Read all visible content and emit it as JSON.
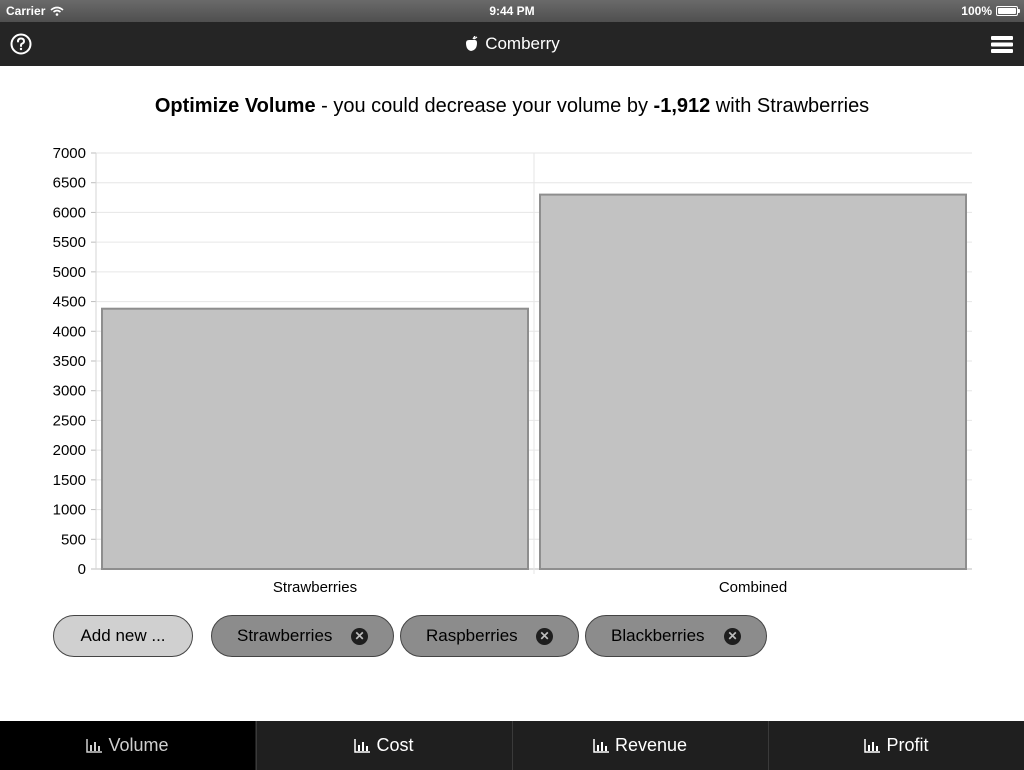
{
  "status": {
    "carrier": "Carrier",
    "time": "9:44 PM",
    "battery": "100%"
  },
  "nav": {
    "title": "Comberry",
    "help_icon": "question-circle-icon",
    "menu_icon": "hamburger-menu-icon"
  },
  "headline": {
    "metric": "Optimize Volume",
    "text_before": " - you could decrease your volume by ",
    "amount": "-1,912",
    "text_after": " with Strawberries"
  },
  "chart_data": {
    "type": "bar",
    "categories": [
      "Strawberries",
      "Combined"
    ],
    "values": [
      4380,
      6300
    ],
    "ylim": [
      0,
      7000
    ],
    "yticks": [
      0,
      500,
      1000,
      1500,
      2000,
      2500,
      3000,
      3500,
      4000,
      4500,
      5000,
      5500,
      6000,
      6500,
      7000
    ],
    "grid": true,
    "bar_color": "#c2c2c2",
    "bar_border": "#8e8e8e"
  },
  "chips": {
    "add_label": "Add new ...",
    "items": [
      {
        "label": "Strawberries"
      },
      {
        "label": "Raspberries"
      },
      {
        "label": "Blackberries"
      }
    ],
    "remove_icon": "close-circle-icon"
  },
  "tabs": [
    {
      "label": "Volume",
      "icon": "bar-chart-icon"
    },
    {
      "label": "Cost",
      "icon": "bar-chart-icon"
    },
    {
      "label": "Revenue",
      "icon": "bar-chart-icon"
    },
    {
      "label": "Profit",
      "icon": "bar-chart-icon"
    }
  ],
  "active_tab": "Volume"
}
